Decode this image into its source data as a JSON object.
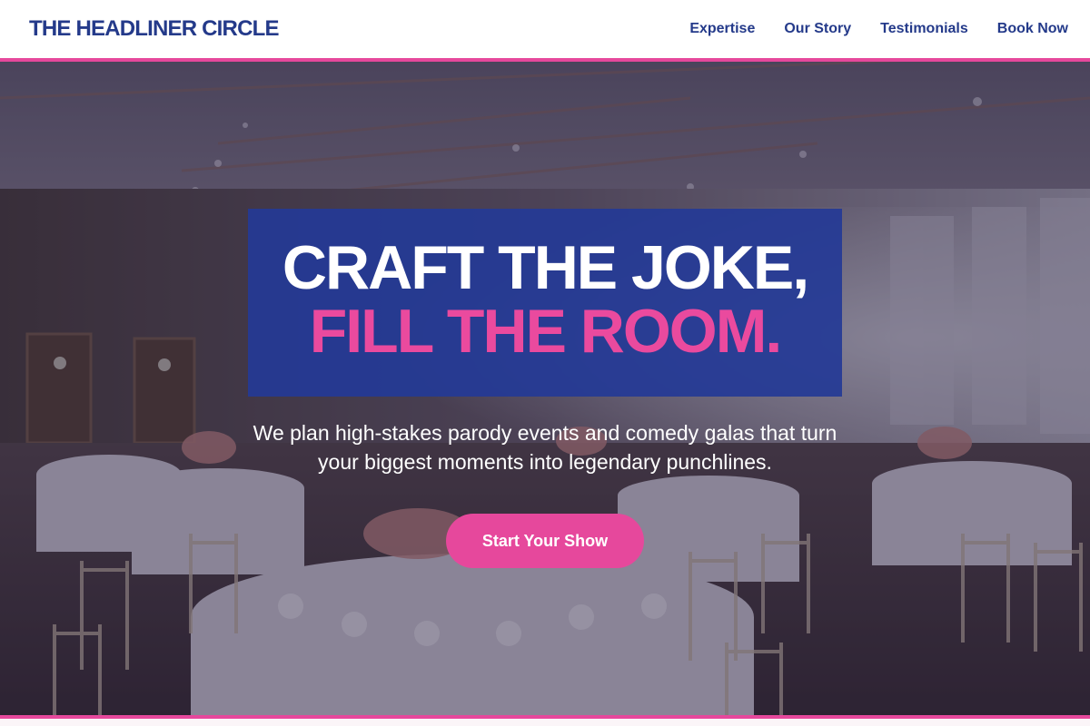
{
  "header": {
    "brand": "THE HEADLINER CIRCLE",
    "nav": [
      {
        "label": "Expertise"
      },
      {
        "label": "Our Story"
      },
      {
        "label": "Testimonials"
      },
      {
        "label": "Book Now"
      }
    ]
  },
  "hero": {
    "headline_line1": "CRAFT THE JOKE,",
    "headline_line2": "FILL THE ROOM.",
    "subtitle_line1": "We plan high-stakes parody events and comedy galas that turn",
    "subtitle_line2": "your biggest moments into legendary punchlines.",
    "cta_label": "Start Your Show",
    "background_image": "banquet-hall-photo"
  },
  "colors": {
    "brand_blue": "#243a8a",
    "accent_pink": "#e6489c",
    "headline_box_blue": "#243a96",
    "white": "#ffffff"
  }
}
